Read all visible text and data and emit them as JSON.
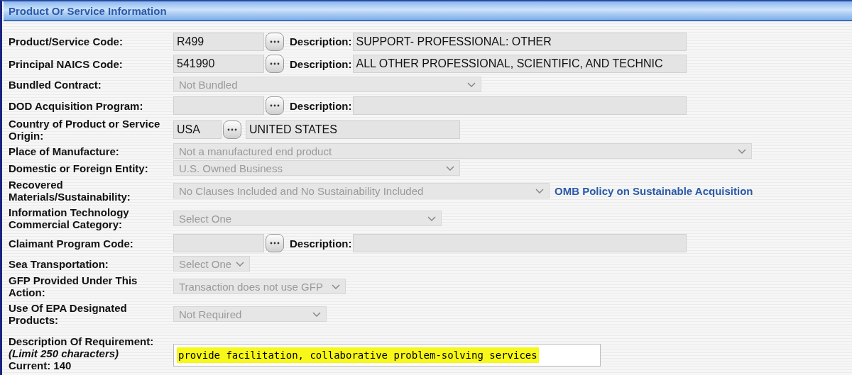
{
  "section": {
    "title": "Product Or Service Information"
  },
  "rows": [
    {
      "kind": "lookup",
      "label": "Product/Service Code:",
      "code": "R499",
      "description_label": "Description:",
      "description": "SUPPORT- PROFESSIONAL: OTHER"
    },
    {
      "kind": "lookup",
      "label": "Principal NAICS Code:",
      "code": "541990",
      "description_label": "Description:",
      "description": "ALL OTHER PROFESSIONAL, SCIENTIFIC, AND TECHNIC"
    },
    {
      "kind": "select",
      "label": "Bundled Contract:",
      "value": "Not Bundled",
      "disabled": true
    },
    {
      "kind": "lookup",
      "label": "DOD Acquisition Program:",
      "description_label": "Description:"
    },
    {
      "kind": "lookup_plain",
      "label": "Country of Product or Service Origin:",
      "code": "USA",
      "description": "UNITED STATES"
    },
    {
      "kind": "select",
      "label": "Place of Manufacture:",
      "value": "Not a manufactured end product",
      "disabled": true
    },
    {
      "kind": "select",
      "label": "Domestic or Foreign Entity:",
      "value": "U.S. Owned Business",
      "disabled": true
    },
    {
      "kind": "select",
      "label": "Recovered Materials/Sustainability:",
      "value": "No Clauses Included and No Sustainability Included",
      "disabled": true,
      "link": "OMB Policy on Sustainable Acquisition"
    },
    {
      "kind": "select",
      "label": "Information Technology Commercial Category:",
      "value": "Select One",
      "disabled": true
    },
    {
      "kind": "lookup",
      "label": "Claimant Program Code:",
      "description_label": "Description:"
    },
    {
      "kind": "select",
      "label": "Sea Transportation:",
      "value": "Select One",
      "disabled": true
    },
    {
      "kind": "select",
      "label": "GFP Provided Under This Action:",
      "value": "Transaction does not use GFP",
      "disabled": true
    },
    {
      "kind": "select",
      "label": "Use Of EPA Designated Products:",
      "value": "Not Required",
      "disabled": true
    },
    {
      "kind": "textarea",
      "label": "Description Of Requirement:",
      "hint": "(Limit 250 characters)",
      "counter": "Current: 140",
      "value": "provide facilitation, collaborative problem-solving services"
    }
  ]
}
